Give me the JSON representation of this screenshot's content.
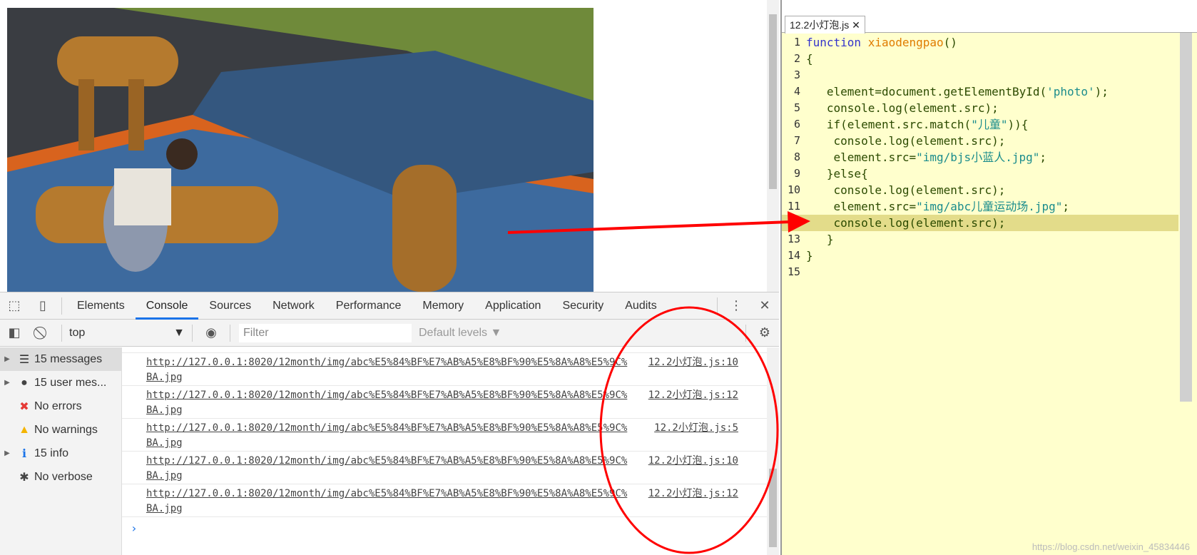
{
  "devtools": {
    "tabs": [
      "Elements",
      "Console",
      "Sources",
      "Network",
      "Performance",
      "Memory",
      "Application",
      "Security",
      "Audits"
    ],
    "active_tab": "Console",
    "context": "top",
    "filter_placeholder": "Filter",
    "levels": "Default levels ▼",
    "sidebar": [
      {
        "label": "15 messages",
        "icon": "list-icon",
        "expandable": true
      },
      {
        "label": "15 user mes...",
        "icon": "user-icon",
        "expandable": true
      },
      {
        "label": "No errors",
        "icon": "error-icon",
        "expandable": false
      },
      {
        "label": "No warnings",
        "icon": "warning-icon",
        "expandable": false
      },
      {
        "label": "15 info",
        "icon": "info-icon",
        "expandable": true
      },
      {
        "label": "No verbose",
        "icon": "bug-icon",
        "expandable": false
      }
    ],
    "messages": [
      {
        "url": "http://127.0.0.1:8020/12month/img/abc%E5%84%BF%E7%AB%A5%E8%BF%90%E5%8A%A8%E5%9C%BA.jpg",
        "source": "12.2小灯泡.js:10"
      },
      {
        "url": "http://127.0.0.1:8020/12month/img/abc%E5%84%BF%E7%AB%A5%E8%BF%90%E5%8A%A8%E5%9C%BA.jpg",
        "source": "12.2小灯泡.js:12"
      },
      {
        "url": "http://127.0.0.1:8020/12month/img/abc%E5%84%BF%E7%AB%A5%E8%BF%90%E5%8A%A8%E5%9C%BA.jpg",
        "source": "12.2小灯泡.js:5"
      },
      {
        "url": "http://127.0.0.1:8020/12month/img/abc%E5%84%BF%E7%AB%A5%E8%BF%90%E5%8A%A8%E5%9C%BA.jpg",
        "source": "12.2小灯泡.js:10"
      },
      {
        "url": "http://127.0.0.1:8020/12month/img/abc%E5%84%BF%E7%AB%A5%E8%BF%90%E5%8A%A8%E5%9C%BA.jpg",
        "source": "12.2小灯泡.js:12"
      }
    ],
    "prompt": "›"
  },
  "editor": {
    "tab": "12.2小灯泡.js",
    "highlight_line": 12,
    "lines": [
      [
        [
          "kw",
          "function "
        ],
        [
          "fn",
          "xiaodengpao"
        ],
        [
          "tx",
          "()"
        ]
      ],
      [
        [
          "tx",
          "{"
        ]
      ],
      [],
      [
        [
          "tx",
          "   element=document.getElementById("
        ],
        [
          "st",
          "'photo'"
        ],
        [
          "tx",
          ");"
        ]
      ],
      [
        [
          "tx",
          "   console.log(element.src);"
        ]
      ],
      [
        [
          "tx",
          "   if(element.src.match("
        ],
        [
          "st",
          "\"儿童\""
        ],
        [
          "tx",
          ")){"
        ]
      ],
      [
        [
          "tx",
          "    console.log(element.src);"
        ]
      ],
      [
        [
          "tx",
          "    element.src="
        ],
        [
          "st",
          "\"img/bjs小蓝人.jpg\""
        ],
        [
          "tx",
          ";"
        ]
      ],
      [
        [
          "tx",
          "   }else{"
        ]
      ],
      [
        [
          "tx",
          "    console.log(element.src);"
        ]
      ],
      [
        [
          "tx",
          "    element.src="
        ],
        [
          "st",
          "\"img/abc儿童运动场.jpg\""
        ],
        [
          "tx",
          ";"
        ]
      ],
      [
        [
          "tx",
          "    console.log(element.src);"
        ]
      ],
      [
        [
          "tx",
          "   }"
        ]
      ],
      [
        [
          "tx",
          "}"
        ]
      ],
      []
    ]
  },
  "watermark": "https://blog.csdn.net/weixin_45834446",
  "colors": {
    "annotation": "#ff0000",
    "editor_bg": "#ffffcd",
    "highlight": "#e3dc8a",
    "accent": "#1a73e8"
  }
}
